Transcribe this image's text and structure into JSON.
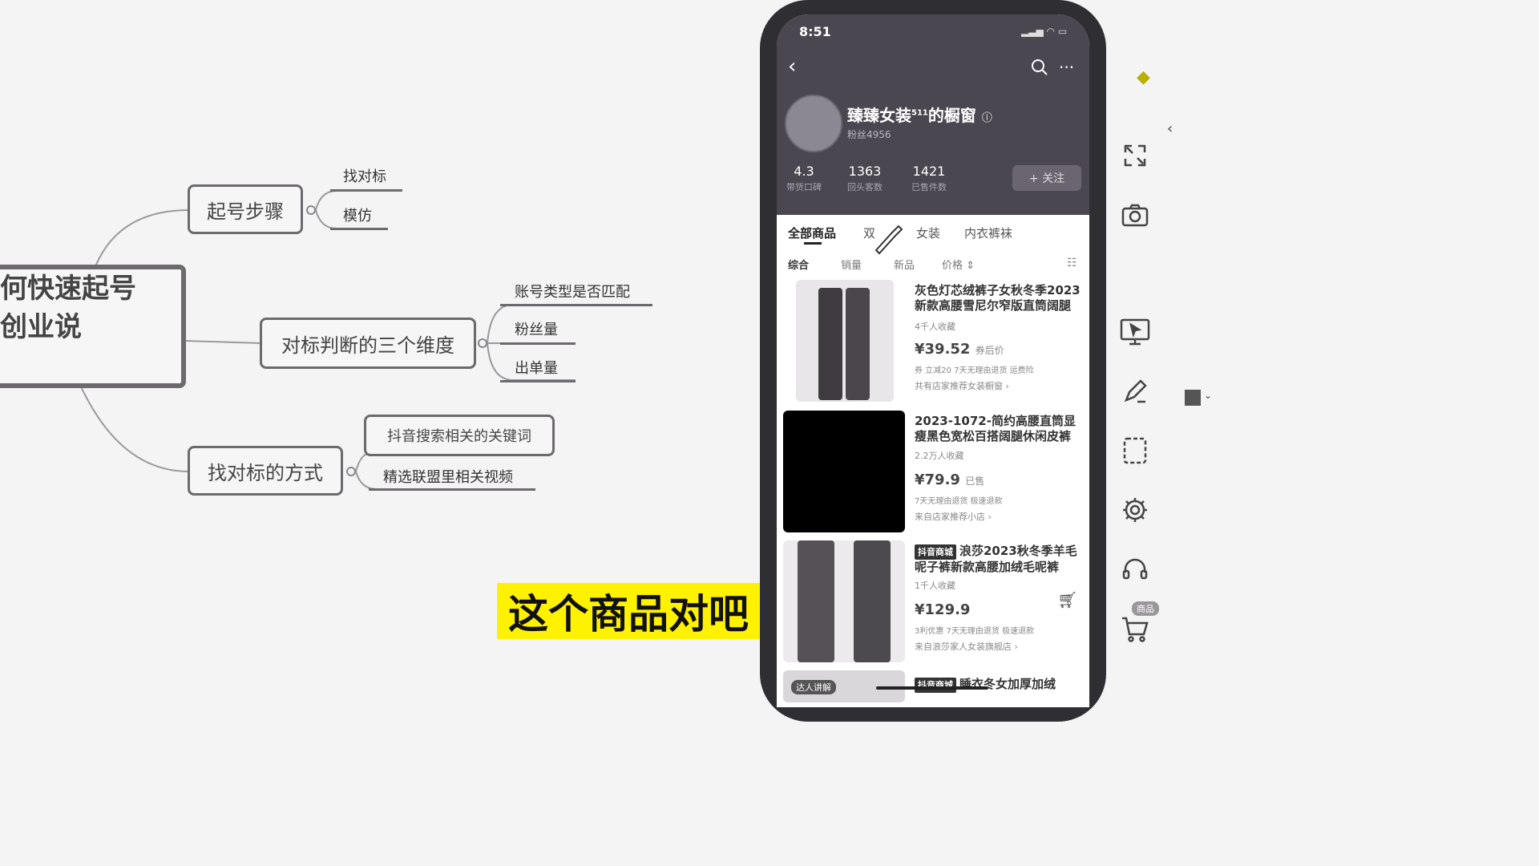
{
  "mindmap": {
    "center": [
      "何快速起号",
      "创业说"
    ],
    "branches": [
      {
        "label": "起号步骤",
        "children": [
          "找对标",
          "模仿"
        ]
      },
      {
        "label": "对标判断的三个维度",
        "children": [
          "账号类型是否匹配",
          "粉丝量",
          "出单量"
        ]
      },
      {
        "label": "找对标的方式",
        "children": [
          "抖音搜索相关的关键词",
          "精选联盟里相关视频"
        ]
      }
    ]
  },
  "caption": "这个商品对吧",
  "phone": {
    "status_time": "8:51",
    "shop": {
      "name": "臻臻女装",
      "name_sup": "511",
      "name_suffix": "的橱窗",
      "fans": "粉丝4956",
      "follow_label": "+ 关注",
      "stats": [
        {
          "value": "4.3",
          "label": "带货口碑"
        },
        {
          "value": "1363",
          "label": "回头客数"
        },
        {
          "value": "1421",
          "label": "已售件数"
        }
      ]
    },
    "tabs": [
      "全部商品",
      "双",
      "女装",
      "内衣裤袜"
    ],
    "sorts": [
      "综合",
      "销量",
      "新品",
      "价格 ⇕"
    ],
    "products": [
      {
        "badge": "",
        "title": "灰色灯芯绒裤子女秋冬季2023新款高腰雪尼尔窄版直筒阔腿",
        "sales": "4千人收藏",
        "price": "¥39.52",
        "price_note": "券后价",
        "tags": "券 立减20   7天无理由退货   运费险",
        "shop": "共有店家推荐女装橱窗 ›"
      },
      {
        "badge": "",
        "title": "2023-1072-简约高腰直筒显瘦黑色宽松百搭阔腿休闲皮裤",
        "sales": "2.2万人收藏",
        "price": "¥79.9",
        "price_note": "已售",
        "tags": "7天无理由退货   极速退款",
        "shop": "来自店家推荐小店 ›"
      },
      {
        "badge": "抖音商城",
        "title": "浪莎2023秋冬季羊毛呢子裤新款高腰加绒毛呢裤",
        "sales": "1千人收藏",
        "price": "¥129.9",
        "price_note": "",
        "tags": "3利优惠   7天无理由退货   极速退款",
        "shop": "来自浪莎家人女装旗舰店 ›"
      },
      {
        "badge": "抖音商城",
        "title": "睡衣冬女加厚加绒",
        "sales": "",
        "price": "",
        "price_note": "",
        "tags": "",
        "shop": "",
        "overlay": "达人讲解"
      }
    ]
  },
  "toolbar": {
    "cart_badge": "商品"
  },
  "colors": {
    "caption_bg": "#fff200",
    "phone_header": "#4b4750",
    "mindmap_border": "#6d6a6e"
  }
}
